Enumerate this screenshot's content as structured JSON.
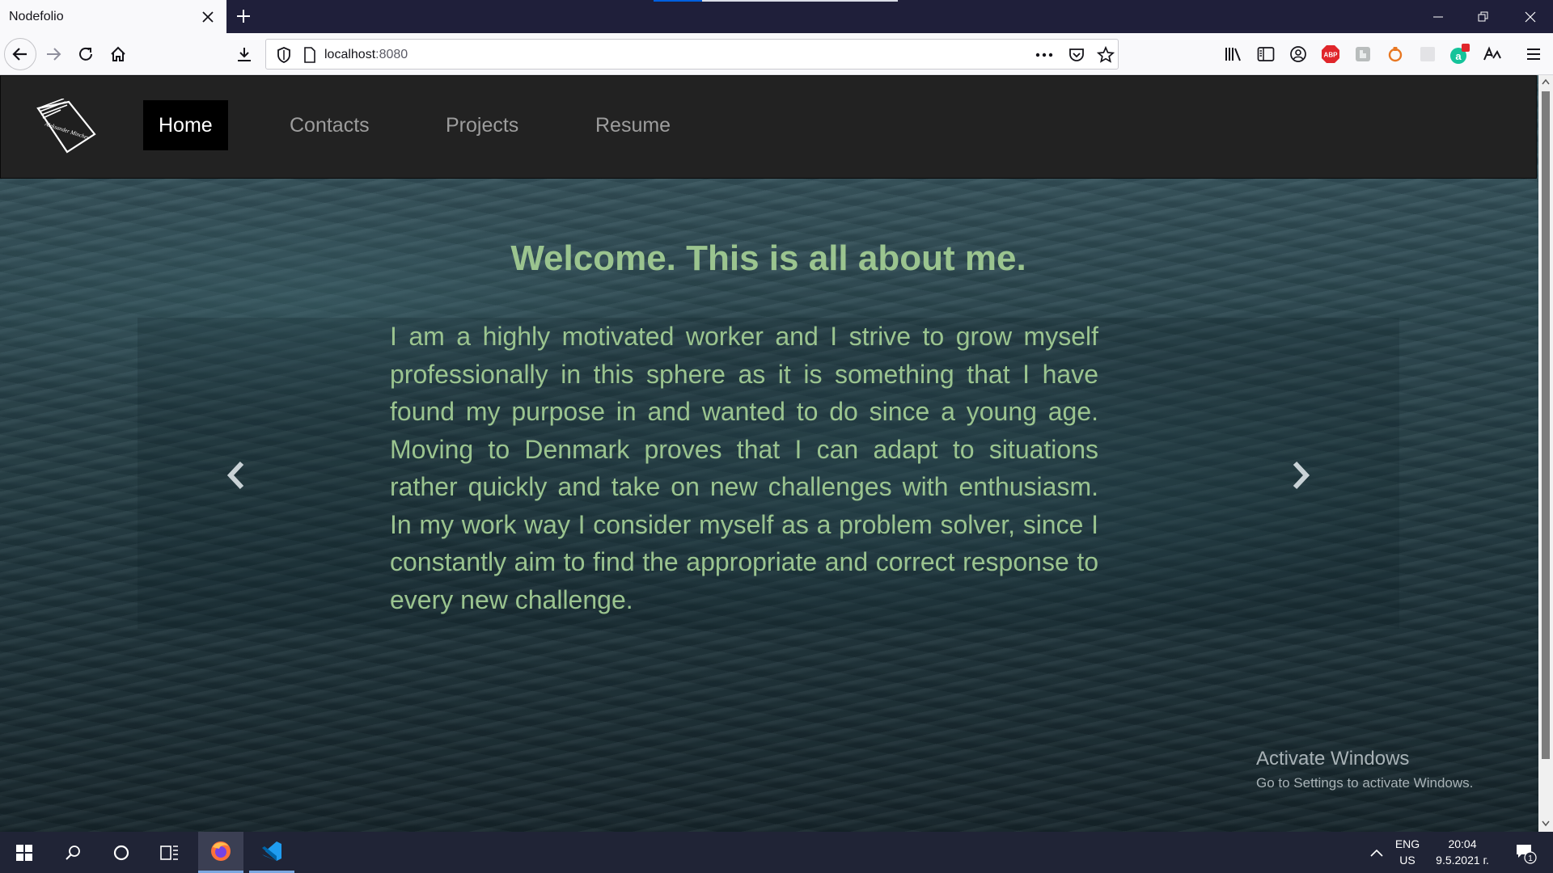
{
  "browser": {
    "tab_title": "Nodefolio",
    "url_host": "localhost",
    "url_port": ":8080",
    "load_progress": 0.2
  },
  "site": {
    "nav": [
      {
        "label": "Home",
        "active": true
      },
      {
        "label": "Contacts",
        "active": false
      },
      {
        "label": "Projects",
        "active": false
      },
      {
        "label": "Resume",
        "active": false
      }
    ],
    "logo_text": "Aleksander Minchev"
  },
  "hero": {
    "title": "Welcome. This is all about me.",
    "body": "I am a highly motivated worker and I strive to grow myself professionally in this sphere as it is something that I have found my purpose in and wanted to do since a young age. Moving to Denmark proves that I can adapt to situations rather quickly and take on new challenges with enthusiasm. In my work way I consider myself as a problem solver, since I constantly aim to find the appropriate and correct response to every new challenge."
  },
  "watermark": {
    "line1": "Activate Windows",
    "line2": "Go to Settings to activate Windows."
  },
  "taskbar": {
    "lang_top": "ENG",
    "lang_bottom": "US",
    "time": "20:04",
    "date": "9.5.2021 г.",
    "notification_count": "1"
  },
  "icons": [
    "back-icon",
    "forward-icon",
    "reload-icon",
    "home-icon",
    "downloads-icon",
    "shield-icon",
    "page-icon",
    "more-icon",
    "pocket-icon",
    "star-icon",
    "library-icon",
    "sidebar-icon",
    "account-icon",
    "adblock-icon",
    "menu-icon"
  ],
  "colors": {
    "accent_text": "#9bc48f",
    "nav_bg": "#222222",
    "active_nav_bg": "#000000"
  }
}
